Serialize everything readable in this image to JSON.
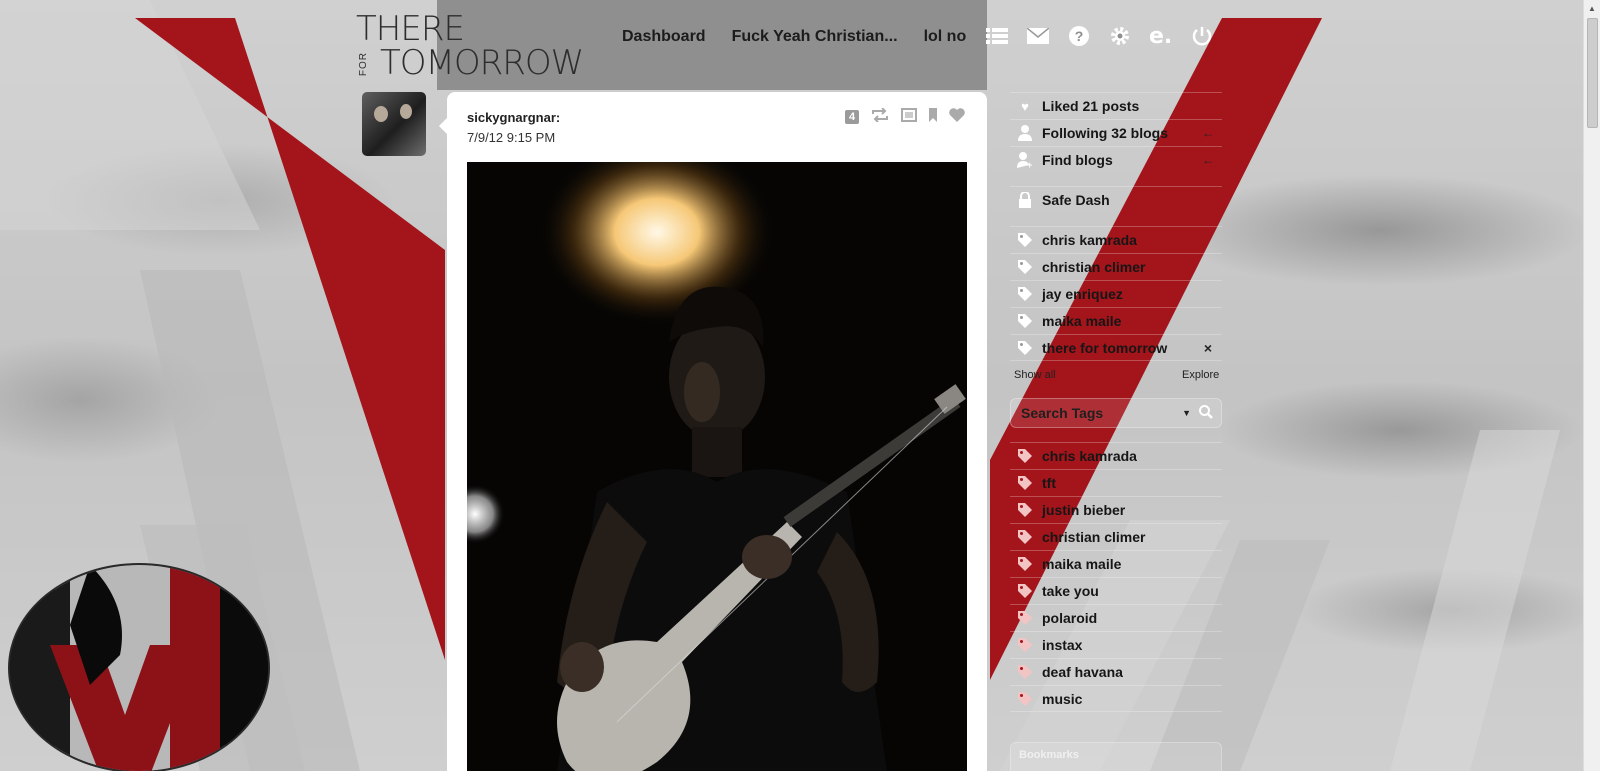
{
  "header": {
    "logo_line1": "THERE",
    "logo_for": "FOR",
    "logo_line2": "TOMORROW",
    "nav": [
      "Dashboard",
      "Fuck Yeah Christian...",
      "lol no"
    ],
    "icons": [
      "list-icon",
      "mail-icon",
      "help-icon",
      "gear-icon",
      "extension-icon",
      "power-icon"
    ]
  },
  "post": {
    "author": "sickygnargnar:",
    "date": "7/9/12 9:15 PM",
    "notes_count": "4",
    "controls": [
      "reblog-icon",
      "edit-icon",
      "bookmark-icon",
      "like-icon"
    ]
  },
  "sidebar": {
    "liked": "Liked 21 posts",
    "following": "Following 32 blogs",
    "find_blogs": "Find blogs",
    "safe_dash": "Safe Dash",
    "tracked_tags": [
      "chris kamrada",
      "christian climer",
      "jay enriquez",
      "maika maile",
      "there for tomorrow"
    ],
    "show_all": "Show all",
    "explore": "Explore",
    "search_placeholder": "Search Tags",
    "recent_tags": [
      "chris kamrada",
      "tft",
      "justin bieber",
      "christian climer",
      "maika maile",
      "take you",
      "polaroid",
      "instax",
      "deaf havana",
      "music"
    ],
    "bookmarks": "Bookmarks",
    "close_glyph": "×",
    "arrow_glyph": "←"
  },
  "colors": {
    "accent_red": "#a3141b",
    "post_bg": "#ffffff",
    "header_strip": "#8f8f8f"
  }
}
